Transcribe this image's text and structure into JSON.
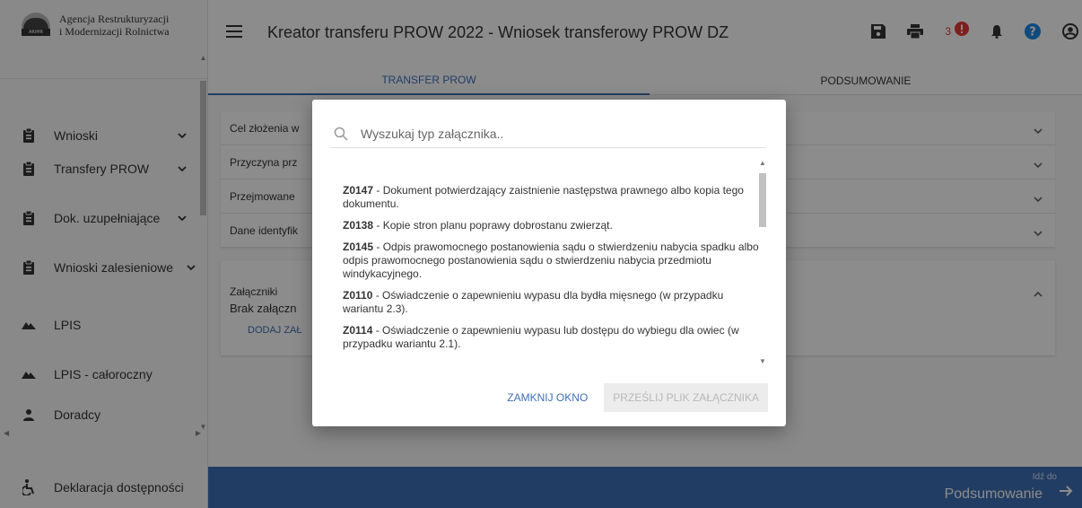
{
  "logo": {
    "line1": "Agencja Restrukturyzacji",
    "line2": "i Modernizacji Rolnictwa",
    "mark_text": "ARiMR"
  },
  "sidebar": {
    "items": [
      {
        "label": "Wnioski",
        "icon": "clipboard-icon",
        "chevron": true
      },
      {
        "label": "Transfery PROW",
        "icon": "clipboard-icon",
        "chevron": true
      },
      {
        "label": "Dok. uzupełniające",
        "icon": "clipboard-icon",
        "chevron": true
      },
      {
        "label": "Wnioski zalesieniowe",
        "icon": "clipboard-icon",
        "chevron": true
      },
      {
        "label": "LPIS",
        "icon": "terrain-icon",
        "chevron": false
      },
      {
        "label": "LPIS - całoroczny",
        "icon": "terrain-icon",
        "chevron": false
      },
      {
        "label": "Doradcy",
        "icon": "person-icon",
        "chevron": false
      },
      {
        "label": "Deklaracja dostępności",
        "icon": "accessibility-icon",
        "chevron": false
      }
    ]
  },
  "header": {
    "title": "Kreator transferu PROW 2022 - Wniosek transferowy PROW DZ",
    "error_count": "3"
  },
  "tabs": [
    {
      "label": "TRANSFER PROW",
      "active": true
    },
    {
      "label": "PODSUMOWANIE",
      "active": false
    }
  ],
  "panels": {
    "rows": [
      "Cel złożenia w",
      "Przyczyna prz",
      "Przejmowane",
      "Dane identyfik"
    ],
    "attachments_title": "Załączniki",
    "attachments_empty": "Brak załączn",
    "attachments_add": "DODAJ ZAŁ"
  },
  "bottombar": {
    "small": "Idź do",
    "big": "Podsumowanie"
  },
  "modal": {
    "search_placeholder": "Wyszukaj typ załącznika..",
    "items": [
      {
        "code": "Z0147",
        "text": " - Dokument potwierdzający zaistnienie następstwa prawnego albo kopia tego dokumentu."
      },
      {
        "code": "Z0138",
        "text": " - Kopie stron planu poprawy dobrostanu zwierząt."
      },
      {
        "code": "Z0145",
        "text": " - Odpis prawomocnego postanowienia sądu o stwierdzeniu nabycia spadku albo odpis prawomocnego postanowienia sądu o stwierdzeniu nabycia przedmiotu windykacyjnego."
      },
      {
        "code": "Z0110",
        "text": " - Oświadczenie o zapewnieniu wypasu dla bydła mięsnego (w przypadku wariantu 2.3)."
      },
      {
        "code": "Z0114",
        "text": " - Oświadczenie o zapewnieniu wypasu lub dostępu do wybiegu dla owiec (w przypadku wariantu 2.1)."
      }
    ],
    "close_label": "ZAMKNIJ OKNO",
    "send_label": "PRZEŚLIJ PLIK ZAŁĄCZNIKA"
  },
  "colors": {
    "accent": "#3f6fb5",
    "error": "#e53935",
    "help": "#1e88e5"
  }
}
